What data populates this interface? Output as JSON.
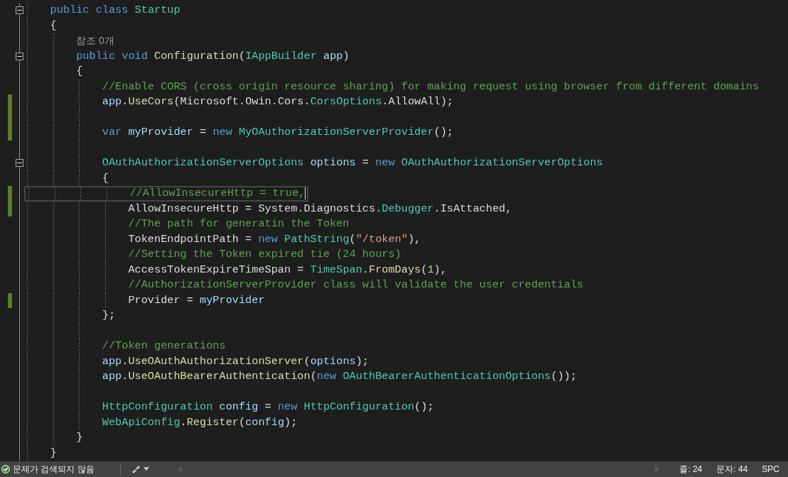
{
  "lines": [
    {
      "kind": "code",
      "expanded": true,
      "changed": false,
      "current": false,
      "tokens": [
        {
          "kind": "kw",
          "text": "public class "
        },
        {
          "kind": "type",
          "text": "Startup"
        }
      ]
    },
    {
      "kind": "code",
      "changed": false,
      "current": false,
      "tokens": [
        {
          "kind": "plain",
          "text": "{"
        }
      ]
    },
    {
      "kind": "block",
      "children": [
        {
          "kind": "codelens",
          "changed": false,
          "current": false,
          "tokens": [
            {
              "kind": "lens",
              "text": "참조 0개"
            }
          ]
        },
        {
          "kind": "code",
          "expanded": true,
          "changed": false,
          "current": false,
          "tokens": [
            {
              "kind": "kw",
              "text": "public void "
            },
            {
              "kind": "method",
              "text": "Configuration"
            },
            {
              "kind": "plain",
              "text": "("
            },
            {
              "kind": "type",
              "text": "IAppBuilder"
            },
            {
              "kind": "var",
              "text": " app"
            },
            {
              "kind": "plain",
              "text": ")"
            }
          ]
        },
        {
          "kind": "code",
          "changed": false,
          "current": false,
          "tokens": [
            {
              "kind": "plain",
              "text": "{"
            }
          ]
        },
        {
          "kind": "block",
          "children": [
            {
              "kind": "code",
              "changed": false,
              "current": false,
              "tokens": [
                {
                  "kind": "comment",
                  "text": "//Enable CORS (cross origin resource sharing) for making request using browser from different domains"
                }
              ]
            },
            {
              "kind": "code",
              "changed": true,
              "current": false,
              "tokens": [
                {
                  "kind": "var",
                  "text": "app"
                },
                {
                  "kind": "plain",
                  "text": "."
                },
                {
                  "kind": "method",
                  "text": "UseCors"
                },
                {
                  "kind": "plain",
                  "text": "(Microsoft.Owin.Cors."
                },
                {
                  "kind": "type",
                  "text": "CorsOptions"
                },
                {
                  "kind": "plain",
                  "text": ".AllowAll);"
                }
              ]
            },
            {
              "kind": "blank",
              "changed": true,
              "current": false
            },
            {
              "kind": "code",
              "changed": true,
              "current": false,
              "tokens": [
                {
                  "kind": "kw",
                  "text": "var "
                },
                {
                  "kind": "var",
                  "text": "myProvider"
                },
                {
                  "kind": "plain",
                  "text": " = "
                },
                {
                  "kind": "kw",
                  "text": "new "
                },
                {
                  "kind": "type",
                  "text": "MyOAuthorizationServerProvider"
                },
                {
                  "kind": "plain",
                  "text": "();"
                }
              ]
            },
            {
              "kind": "blank",
              "changed": false,
              "current": false
            },
            {
              "kind": "code",
              "expanded": true,
              "changed": false,
              "current": false,
              "tokens": [
                {
                  "kind": "type",
                  "text": "OAuthAuthorizationServerOptions"
                },
                {
                  "kind": "var",
                  "text": " options"
                },
                {
                  "kind": "plain",
                  "text": " = "
                },
                {
                  "kind": "kw",
                  "text": "new "
                },
                {
                  "kind": "type",
                  "text": "OAuthAuthorizationServerOptions"
                }
              ]
            },
            {
              "kind": "code",
              "changed": false,
              "current": false,
              "tokens": [
                {
                  "kind": "plain",
                  "text": "{"
                }
              ]
            },
            {
              "kind": "block",
              "children": [
                {
                  "kind": "code",
                  "changed": true,
                  "current": true,
                  "tokens": [
                    {
                      "kind": "comment",
                      "text": "//AllowInsecureHttp = true,"
                    }
                  ]
                },
                {
                  "kind": "code",
                  "changed": true,
                  "current": false,
                  "tokens": [
                    {
                      "kind": "plain",
                      "text": "AllowInsecureHttp = System.Diagnostics."
                    },
                    {
                      "kind": "type",
                      "text": "Debugger"
                    },
                    {
                      "kind": "plain",
                      "text": ".IsAttached,"
                    }
                  ]
                },
                {
                  "kind": "code",
                  "changed": false,
                  "current": false,
                  "tokens": [
                    {
                      "kind": "comment",
                      "text": "//The path for generatin the Token"
                    }
                  ]
                },
                {
                  "kind": "code",
                  "changed": false,
                  "current": false,
                  "tokens": [
                    {
                      "kind": "plain",
                      "text": "TokenEndpointPath = "
                    },
                    {
                      "kind": "kw",
                      "text": "new "
                    },
                    {
                      "kind": "type",
                      "text": "PathString"
                    },
                    {
                      "kind": "plain",
                      "text": "("
                    },
                    {
                      "kind": "string",
                      "text": "\"/token\""
                    },
                    {
                      "kind": "plain",
                      "text": "),"
                    }
                  ]
                },
                {
                  "kind": "code",
                  "changed": false,
                  "current": false,
                  "tokens": [
                    {
                      "kind": "comment",
                      "text": "//Setting the Token expired tie (24 hours)"
                    }
                  ]
                },
                {
                  "kind": "code",
                  "changed": false,
                  "current": false,
                  "tokens": [
                    {
                      "kind": "plain",
                      "text": "AccessTokenExpireTimeSpan = "
                    },
                    {
                      "kind": "type",
                      "text": "TimeSpan"
                    },
                    {
                      "kind": "plain",
                      "text": "."
                    },
                    {
                      "kind": "method",
                      "text": "FromDays"
                    },
                    {
                      "kind": "plain",
                      "text": "("
                    },
                    {
                      "kind": "number",
                      "text": "1"
                    },
                    {
                      "kind": "plain",
                      "text": "),"
                    }
                  ]
                },
                {
                  "kind": "code",
                  "changed": false,
                  "current": false,
                  "tokens": [
                    {
                      "kind": "comment",
                      "text": "//AuthorizationServerProvider class will validate the user credentials"
                    }
                  ]
                },
                {
                  "kind": "code",
                  "changed": true,
                  "current": false,
                  "tokens": [
                    {
                      "kind": "plain",
                      "text": "Provider = "
                    },
                    {
                      "kind": "var",
                      "text": "myProvider"
                    }
                  ]
                }
              ]
            },
            {
              "kind": "code",
              "changed": false,
              "current": false,
              "tokens": [
                {
                  "kind": "plain",
                  "text": "};"
                }
              ]
            },
            {
              "kind": "blank",
              "changed": false,
              "current": false
            },
            {
              "kind": "code",
              "changed": false,
              "current": false,
              "tokens": [
                {
                  "kind": "comment",
                  "text": "//Token generations"
                }
              ]
            },
            {
              "kind": "code",
              "changed": false,
              "current": false,
              "tokens": [
                {
                  "kind": "var",
                  "text": "app"
                },
                {
                  "kind": "plain",
                  "text": "."
                },
                {
                  "kind": "method",
                  "text": "UseOAuthAuthorizationServer"
                },
                {
                  "kind": "plain",
                  "text": "("
                },
                {
                  "kind": "var",
                  "text": "options"
                },
                {
                  "kind": "plain",
                  "text": ");"
                }
              ]
            },
            {
              "kind": "code",
              "changed": false,
              "current": false,
              "tokens": [
                {
                  "kind": "var",
                  "text": "app"
                },
                {
                  "kind": "plain",
                  "text": "."
                },
                {
                  "kind": "method",
                  "text": "UseOAuthBearerAuthentication"
                },
                {
                  "kind": "plain",
                  "text": "("
                },
                {
                  "kind": "kw",
                  "text": "new "
                },
                {
                  "kind": "type",
                  "text": "OAuthBearerAuthenticationOptions"
                },
                {
                  "kind": "plain",
                  "text": "());"
                }
              ]
            },
            {
              "kind": "blank",
              "changed": false,
              "current": false
            },
            {
              "kind": "code",
              "changed": false,
              "current": false,
              "tokens": [
                {
                  "kind": "type",
                  "text": "HttpConfiguration"
                },
                {
                  "kind": "var",
                  "text": " config"
                },
                {
                  "kind": "plain",
                  "text": " = "
                },
                {
                  "kind": "kw",
                  "text": "new "
                },
                {
                  "kind": "type",
                  "text": "HttpConfiguration"
                },
                {
                  "kind": "plain",
                  "text": "();"
                }
              ]
            },
            {
              "kind": "code",
              "changed": false,
              "current": false,
              "tokens": [
                {
                  "kind": "type",
                  "text": "WebApiConfig"
                },
                {
                  "kind": "plain",
                  "text": "."
                },
                {
                  "kind": "method",
                  "text": "Register"
                },
                {
                  "kind": "plain",
                  "text": "("
                },
                {
                  "kind": "var",
                  "text": "config"
                },
                {
                  "kind": "plain",
                  "text": ");"
                }
              ]
            }
          ]
        },
        {
          "kind": "code",
          "changed": false,
          "current": false,
          "tokens": [
            {
              "kind": "plain",
              "text": "}"
            }
          ]
        }
      ]
    },
    {
      "kind": "code",
      "changed": false,
      "current": false,
      "tokens": [
        {
          "kind": "plain",
          "text": "}"
        }
      ]
    }
  ],
  "status_bar": {
    "issues": "문제가 검색되지 않음",
    "line": "줄: 24",
    "column": "문자: 44",
    "whitespace": "SPC"
  }
}
